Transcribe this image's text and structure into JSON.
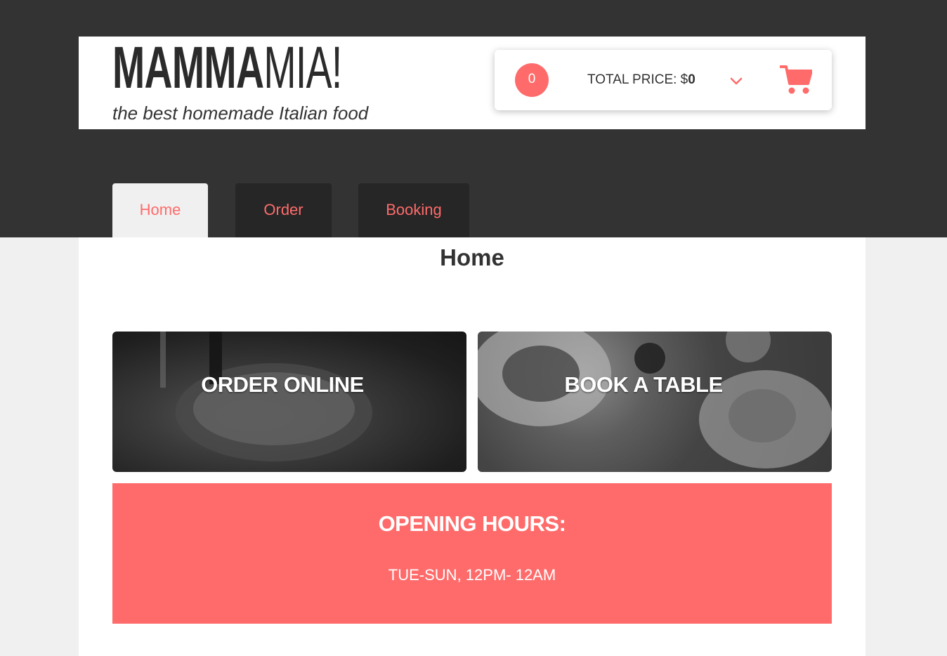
{
  "header": {
    "logo_bold": "MAMMA",
    "logo_light": "MIA!",
    "tagline": "the best homemade Italian food"
  },
  "cart": {
    "count": "0",
    "total_label": "TOTAL PRICE: $",
    "total_value": "0",
    "toggle_icon": "chevron-down-icon",
    "cart_icon": "shopping-cart-icon"
  },
  "nav": {
    "tabs": [
      {
        "label": "Home",
        "active": true
      },
      {
        "label": "Order",
        "active": false
      },
      {
        "label": "Booking",
        "active": false
      }
    ]
  },
  "main": {
    "title": "Home",
    "tiles": [
      {
        "label": "ORDER ONLINE"
      },
      {
        "label": "BOOK A TABLE"
      }
    ],
    "hours": {
      "title": "OPENING HOURS:",
      "text": "TUE-SUN, 12PM- 12AM"
    }
  },
  "colors": {
    "accent": "#ff6b6b",
    "dark_band": "#333333",
    "nav_tab": "#262626",
    "page_bg": "#f0f0f0"
  }
}
